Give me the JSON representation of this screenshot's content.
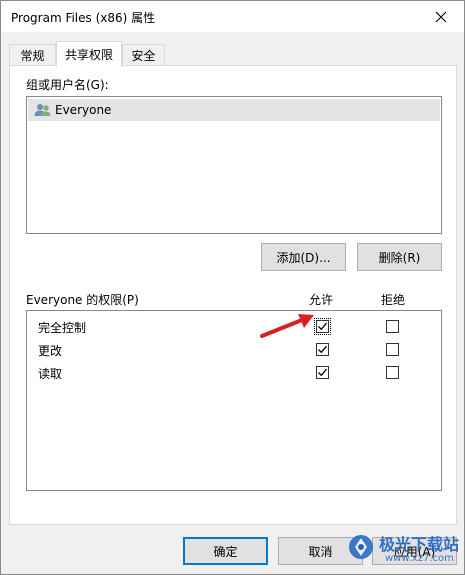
{
  "window": {
    "title": "Program Files (x86) 属性"
  },
  "tabs": [
    {
      "label": "常规",
      "active": false
    },
    {
      "label": "共享权限",
      "active": true
    },
    {
      "label": "安全",
      "active": false
    }
  ],
  "groups": {
    "label": "组或用户名(G):",
    "items": [
      {
        "name": "Everyone",
        "icon": "users-group-icon",
        "selected": true
      }
    ]
  },
  "group_buttons": {
    "add": "添加(D)...",
    "remove": "删除(R)"
  },
  "permissions": {
    "label": "Everyone 的权限(P)",
    "col_allow": "允许",
    "col_deny": "拒绝",
    "rows": [
      {
        "name": "完全控制",
        "allow": true,
        "deny": false
      },
      {
        "name": "更改",
        "allow": true,
        "deny": false
      },
      {
        "name": "读取",
        "allow": true,
        "deny": false
      }
    ]
  },
  "footer": {
    "ok": "确定",
    "cancel": "取消",
    "apply": "应用(A)"
  },
  "watermark": {
    "text": "极光下载站",
    "url": "www.xz7.com"
  }
}
